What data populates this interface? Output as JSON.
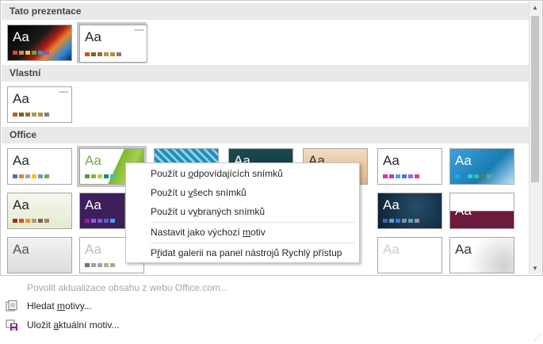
{
  "sections": {
    "this_presentation": "Tato prezentace",
    "custom": "Vlastní",
    "office": "Office"
  },
  "thumb_label": "Aa",
  "thumb_tiny_label": "sadxla",
  "footer": {
    "enable_updates": "Povolit aktualizace obsahu z webu Office.com...",
    "browse_pre": "Hledat ",
    "browse_ul": "m",
    "browse_post": "otivy...",
    "save_pre": "Uložit ",
    "save_ul": "a",
    "save_post": "ktuální motiv..."
  },
  "context_menu": {
    "item1_pre": "Použít u ",
    "item1_ul": "o",
    "item1_post": "dpovídajících snímků",
    "item2_pre": "Použít u ",
    "item2_ul": "v",
    "item2_post": "šech snímků",
    "item3_pre": "Použít u v",
    "item3_ul": "y",
    "item3_post": "braných snímků",
    "item4_pre": "Nastavit jako výchozí ",
    "item4_ul": "m",
    "item4_post": "otiv",
    "item5_pre": "P",
    "item5_ul": "ř",
    "item5_post": "idat galerii na panel nástrojů Rychlý přístup"
  },
  "colors": {
    "accent_header_bg": "#e9e9e9",
    "hover_border": "#c8c8c8"
  }
}
